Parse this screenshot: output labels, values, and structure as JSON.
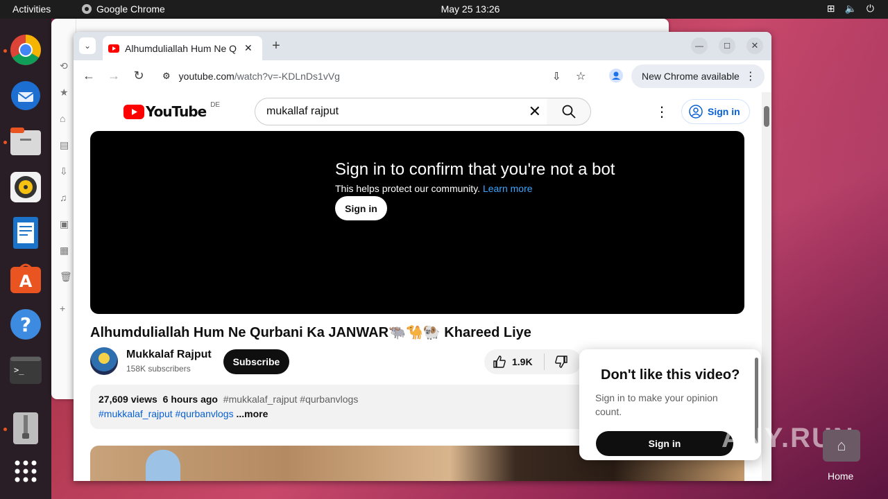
{
  "topbar": {
    "activities": "Activities",
    "app_name": "Google Chrome",
    "clock": "May 25  13:26"
  },
  "chrome": {
    "tab_title": "Alhumduliallah Hum Ne Q",
    "url_host": "youtube.com",
    "url_path": "/watch?v=-KDLnDs1vVg",
    "update_label": "New Chrome available"
  },
  "youtube": {
    "logo_text": "YouTube",
    "region": "DE",
    "search_value": "mukallaf rajput",
    "sign_in": "Sign in",
    "player": {
      "title": "Sign in to confirm that you're not a bot",
      "subtitle": "This helps protect our community.",
      "learn_more": "Learn more",
      "button": "Sign in"
    },
    "video_title": "Alhumduliallah Hum Ne Qurbani Ka JANWAR🐃🐪🐏 Khareed Liye",
    "channel": {
      "name": "Mukkalaf Rajput",
      "subscribers": "158K subscribers",
      "subscribe": "Subscribe"
    },
    "likes": "1.9K",
    "description": {
      "views": "27,609 views",
      "age": "6 hours ago",
      "tags_line1": "#mukkalaf_rajput #qurbanvlogs",
      "tags_line2": "#mukkalaf_rajput #qurbanvlogs",
      "more": "...more"
    },
    "dislike_popup": {
      "title": "Don't like this video?",
      "body": "Sign in to make your opinion count.",
      "button": "Sign in"
    }
  },
  "desktop": {
    "watermark": "ANY.RUN",
    "home_label": "Home"
  },
  "colors": {
    "youtube_red": "#ff0000",
    "link_blue": "#065fd4",
    "ubuntu_orange": "#e95420"
  }
}
